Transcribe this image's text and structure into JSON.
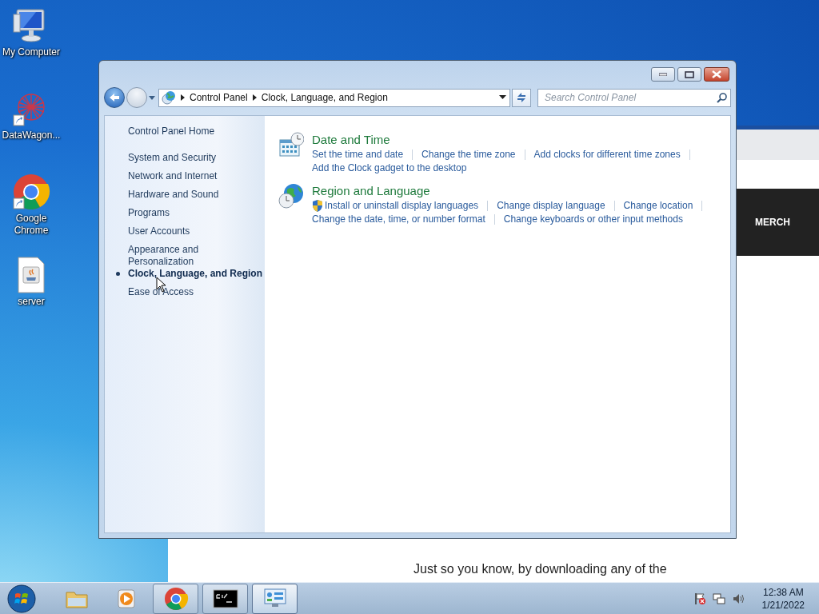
{
  "desktop_icons": [
    {
      "label": "My Computer",
      "kind": "computer"
    },
    {
      "label": "DataWagon...",
      "kind": "datawagon"
    },
    {
      "label": "Google Chrome",
      "kind": "chrome"
    },
    {
      "label": "server",
      "kind": "java"
    }
  ],
  "background_window": {
    "nav_item": "MERCH",
    "text": "Just so you know, by downloading any of the"
  },
  "explorer": {
    "breadcrumb": [
      "Control Panel",
      "Clock, Language, and Region"
    ],
    "search": {
      "placeholder": "Search Control Panel"
    },
    "sidebar": {
      "home": "Control Panel Home",
      "items": [
        {
          "label": "System and Security",
          "selected": false
        },
        {
          "label": "Network and Internet",
          "selected": false
        },
        {
          "label": "Hardware and Sound",
          "selected": false
        },
        {
          "label": "Programs",
          "selected": false
        },
        {
          "label": "User Accounts",
          "selected": false
        },
        {
          "label": "Appearance and Personalization",
          "selected": false
        },
        {
          "label": "Clock, Language, and Region",
          "selected": true
        },
        {
          "label": "Ease of Access",
          "selected": false
        }
      ]
    },
    "categories": [
      {
        "title": "Date and Time",
        "kind": "calendar",
        "lines": [
          [
            {
              "label": "Set the time and date",
              "shield": false
            },
            {
              "label": "Change the time zone",
              "shield": false
            },
            {
              "label": "Add clocks for different time zones",
              "shield": false
            }
          ],
          [
            {
              "label": "Add the Clock gadget to the desktop",
              "shield": false
            }
          ]
        ]
      },
      {
        "title": "Region and Language",
        "kind": "globe",
        "lines": [
          [
            {
              "label": "Install or uninstall display languages",
              "shield": true
            },
            {
              "label": "Change display language",
              "shield": false
            },
            {
              "label": "Change location",
              "shield": false
            }
          ],
          [
            {
              "label": "Change the date, time, or number format",
              "shield": false
            },
            {
              "label": "Change keyboards or other input methods",
              "shield": false
            }
          ]
        ]
      }
    ]
  },
  "taskbar": {
    "apps": [
      {
        "kind": "folder",
        "running": false,
        "selected": false
      },
      {
        "kind": "media",
        "running": false,
        "selected": false
      },
      {
        "kind": "chrome",
        "running": true,
        "selected": false
      },
      {
        "kind": "console",
        "running": true,
        "selected": false
      },
      {
        "kind": "panel",
        "running": true,
        "selected": true
      }
    ],
    "time": "12:38 AM",
    "date": "1/21/2022"
  }
}
